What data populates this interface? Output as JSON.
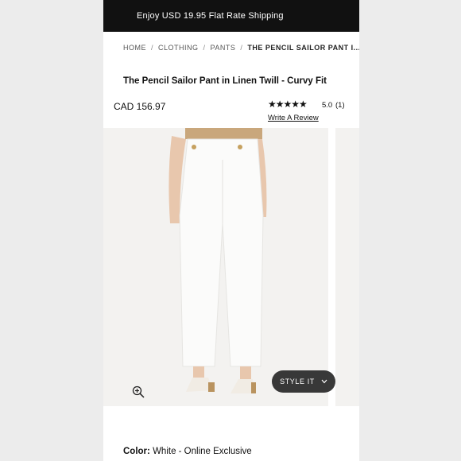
{
  "promo": {
    "text": "Enjoy USD 19.95 Flat Rate Shipping"
  },
  "breadcrumb": {
    "items": [
      "HOME",
      "CLOTHING",
      "PANTS"
    ],
    "current": "THE PENCIL SAILOR PANT I...",
    "separator": "/"
  },
  "product": {
    "title": "The Pencil Sailor Pant in Linen Twill - Curvy Fit",
    "price": "CAD 156.97",
    "stars": "★★★★★",
    "rating": "5.0",
    "review_count": "(1)",
    "write_review": "Write A Review"
  },
  "actions": {
    "style_it": "STYLE IT"
  },
  "color": {
    "label": "Color:",
    "value": "White - Online Exclusive"
  },
  "icons": [
    "zoom-in-icon",
    "chevron-down-icon",
    "star-icon"
  ],
  "colors": {
    "promo_bg": "#111111",
    "page_bg": "#ffffff",
    "pill_bg": "#1e1e1e"
  }
}
